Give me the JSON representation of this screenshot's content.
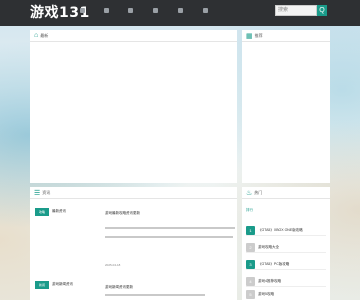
{
  "header": {
    "logo": "游戏131",
    "search_placeholder": "搜索",
    "search_button": "Q"
  },
  "main_panel": {
    "title": "最新"
  },
  "side_panel": {
    "title": "推荐"
  },
  "list_panel": {
    "title": "资讯"
  },
  "hot_panel": {
    "title": "热门",
    "subtitle": "排行"
  },
  "list_items": [
    {
      "tag": "攻略",
      "side_label": "最新资讯",
      "title": "游戏最新攻略资讯更新",
      "date": "2025-04-18"
    },
    {
      "tag": "新闻",
      "side_label": "游戏新闻资讯",
      "title": "游戏新闻资讯更新"
    }
  ],
  "hot_items": [
    {
      "num": "1",
      "text": "《GTA5》XBOX ONE版攻略"
    },
    {
      "num": "2",
      "text": "游戏攻略大全"
    },
    {
      "num": "3",
      "text": "《GTA5》PC版攻略"
    },
    {
      "num": "4",
      "text": "游戏4推荐攻略"
    },
    {
      "num": "5",
      "text": "游戏5攻略"
    }
  ]
}
